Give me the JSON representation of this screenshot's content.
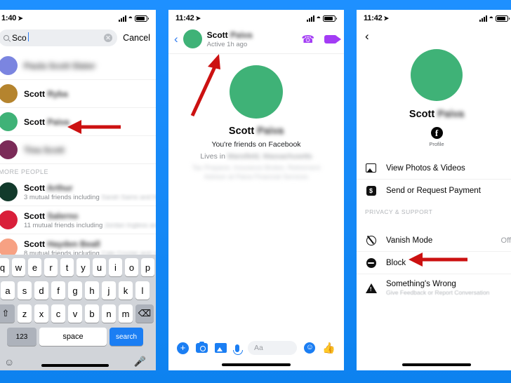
{
  "theme": {
    "background": "#1e90ff",
    "accent_blue": "#1b7ef3",
    "link_blue": "#2f7bf0",
    "arrow_red": "#cc1111",
    "purple": "#a33cf5"
  },
  "panel1": {
    "status": {
      "time": "1:40",
      "location_icon": "location-arrow-icon",
      "signal": "signal-bars-icon",
      "wifi": "wifi-icon",
      "battery": "battery-icon"
    },
    "search": {
      "value": "Sco",
      "placeholder": "Search",
      "clear_label": "✕",
      "cancel_label": "Cancel",
      "magnifier": "search-icon"
    },
    "results": [
      {
        "name_visible": "",
        "name_blurred": "Paula Scott Slater",
        "avatar_color": "#7b85e0",
        "dim": true,
        "sub": "",
        "sub_blurred": ""
      },
      {
        "name_visible": "Scott",
        "name_blurred": "Ryba",
        "avatar_color": "#b5842e",
        "dim": false,
        "sub": "",
        "sub_blurred": ""
      },
      {
        "name_visible": "Scott",
        "name_blurred": "Paiva",
        "avatar_color": "#3fb277",
        "dim": false,
        "sub": "",
        "sub_blurred": ""
      },
      {
        "name_visible": "",
        "name_blurred": "Tina Scott",
        "avatar_color": "#7b2b58",
        "dim": true,
        "sub": "",
        "sub_blurred": ""
      }
    ],
    "section_header": "MORE PEOPLE",
    "more_people": [
      {
        "name_visible": "Scott",
        "name_blurred": "Arthur",
        "avatar_color": "#123a2b",
        "sub": "3 mutual friends including",
        "sub_blurred": "Sarah Sams and Ken..."
      },
      {
        "name_visible": "Scott",
        "name_blurred": "Salerno",
        "avatar_color": "#d91f3a",
        "sub": "11 mutual friends including",
        "sub_blurred": "Jordan Ingless and D..."
      },
      {
        "name_visible": "Scott",
        "name_blurred": "Hayden Beall",
        "avatar_color": "#f7a183",
        "sub": "8 mutual friends including",
        "sub_blurred": "Cale Crozier and Jere..."
      }
    ],
    "keyboard": {
      "row1": [
        "q",
        "w",
        "e",
        "r",
        "t",
        "y",
        "u",
        "i",
        "o",
        "p"
      ],
      "row2": [
        "a",
        "s",
        "d",
        "f",
        "g",
        "h",
        "j",
        "k",
        "l"
      ],
      "row3": [
        "z",
        "x",
        "c",
        "v",
        "b",
        "n",
        "m"
      ],
      "shift_label": "⇧",
      "backspace_label": "⌫",
      "numbers_label": "123",
      "space_label": "space",
      "search_label": "search",
      "emoji_icon": "emoji-icon",
      "mic_icon": "microphone-icon"
    }
  },
  "panel2": {
    "status": {
      "time": "11:42",
      "location_icon": "location-arrow-icon"
    },
    "header": {
      "back_label": "‹",
      "name_visible": "Scott",
      "name_blurred": "Paiva",
      "active_status": "Active 1h ago",
      "avatar_color": "#3fb277",
      "phone_icon": "phone-call-icon",
      "video_icon": "video-camera-icon"
    },
    "profile": {
      "avatar_color": "#3fb277",
      "name_visible": "Scott",
      "name_blurred": "Paiva",
      "friend_status": "You're friends on Facebook",
      "lives_in_prefix": "Lives in",
      "lives_in_blurred": "Mansfield, Massachusetts",
      "work_blurred": "Tax Preparer, Insurance Broker, Retirement Advisor at Paiva Financial Services"
    },
    "composer": {
      "plus_label": "+",
      "camera_icon": "camera-icon",
      "gallery_icon": "photo-gallery-icon",
      "mic_icon": "microphone-icon",
      "input_placeholder": "Aa",
      "emoji_label": "☺",
      "like_label": "👍"
    }
  },
  "panel3": {
    "status": {
      "time": "11:42",
      "location_icon": "location-arrow-icon"
    },
    "back_label": "‹",
    "profile": {
      "avatar_color": "#3fb277",
      "name_visible": "Scott",
      "name_blurred": "Paiva",
      "fb_glyph": "f",
      "fb_label": "Profile"
    },
    "menu": [
      {
        "label": "View Photos & Videos",
        "icon": "photo-icon",
        "sub": "",
        "value": ""
      },
      {
        "label": "Send or Request Payment",
        "icon": "payment-icon",
        "sub": "",
        "value": ""
      }
    ],
    "section_header": "PRIVACY & SUPPORT",
    "menu2": [
      {
        "label": "Vanish Mode",
        "icon": "vanish-mode-icon",
        "sub": "",
        "value": "Off"
      },
      {
        "label": "Block",
        "icon": "block-icon",
        "sub": "",
        "value": ""
      },
      {
        "label": "Something's Wrong",
        "icon": "warning-icon",
        "sub": "Give Feedback or Report Conversation",
        "value": ""
      }
    ]
  },
  "annotations": [
    {
      "name": "arrow-to-scott-paiva-result",
      "direction": "left"
    },
    {
      "name": "arrow-to-chat-avatar",
      "direction": "up-right"
    },
    {
      "name": "arrow-to-block",
      "direction": "left"
    }
  ]
}
